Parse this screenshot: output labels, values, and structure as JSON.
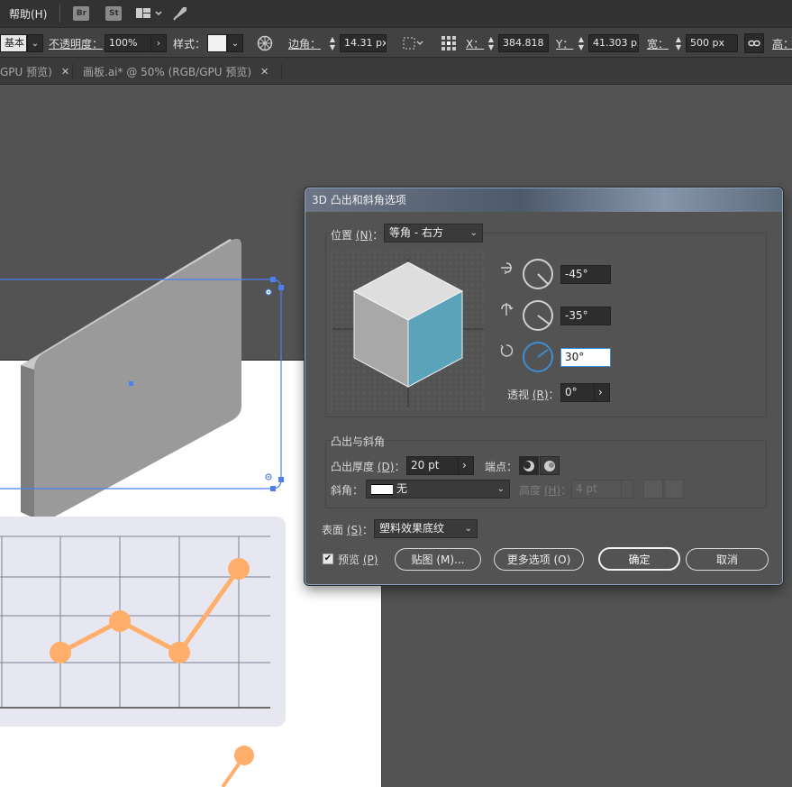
{
  "menubar": {
    "help": "帮助(H)",
    "bridge": "Br",
    "stock": "St"
  },
  "control": {
    "style_preset": "基本",
    "opacity_label": "不透明度：",
    "opacity_value": "100%",
    "style_label": "样式：",
    "corner_label": "边角：",
    "corner_value": "14.31 px",
    "x_label": "X：",
    "x_value": "384.818 px",
    "y_label": "Y：",
    "y_value": "41.303 px",
    "w_label": "宽：",
    "w_value": "500 px",
    "h_label": "高："
  },
  "tabs": [
    {
      "label": "GPU 预览)"
    },
    {
      "label": "画板.ai* @ 50% (RGB/GPU 预览)"
    }
  ],
  "chart_data": {
    "type": "line",
    "values": [
      1.4,
      2.0,
      1.4,
      3.0
    ],
    "color": "#FFAE6B"
  },
  "dialog": {
    "title": "3D 凸出和斜角选项",
    "position_label": "位置",
    "position_hotkey": "(N)",
    "position_value": "等角 - 右方",
    "rotate_x": "-45°",
    "rotate_y": "-35°",
    "rotate_z": "30°",
    "perspective_label": "透视",
    "perspective_hotkey": "(R)",
    "perspective_value": "0°",
    "extrude_section": "凸出与斜角",
    "extrude_depth_label": "凸出厚度",
    "extrude_depth_hotkey": "(D)",
    "extrude_depth_value": "20 pt",
    "cap_label": "端点：",
    "bevel_label": "斜角：",
    "bevel_value": "无",
    "height_label": "高度",
    "height_hotkey": "(H)",
    "height_value": "4 pt",
    "surface_label": "表面",
    "surface_hotkey": "(S)",
    "surface_value": "塑料效果底纹",
    "preview_label": "预览",
    "preview_hotkey": "(P)",
    "map_button": "贴图 (M)...",
    "more_button": "更多选项 (O)",
    "ok_button": "确定",
    "cancel_button": "取消",
    "cube_side_color": "#5BA3B8",
    "accent_color": "#3D8DD6"
  }
}
